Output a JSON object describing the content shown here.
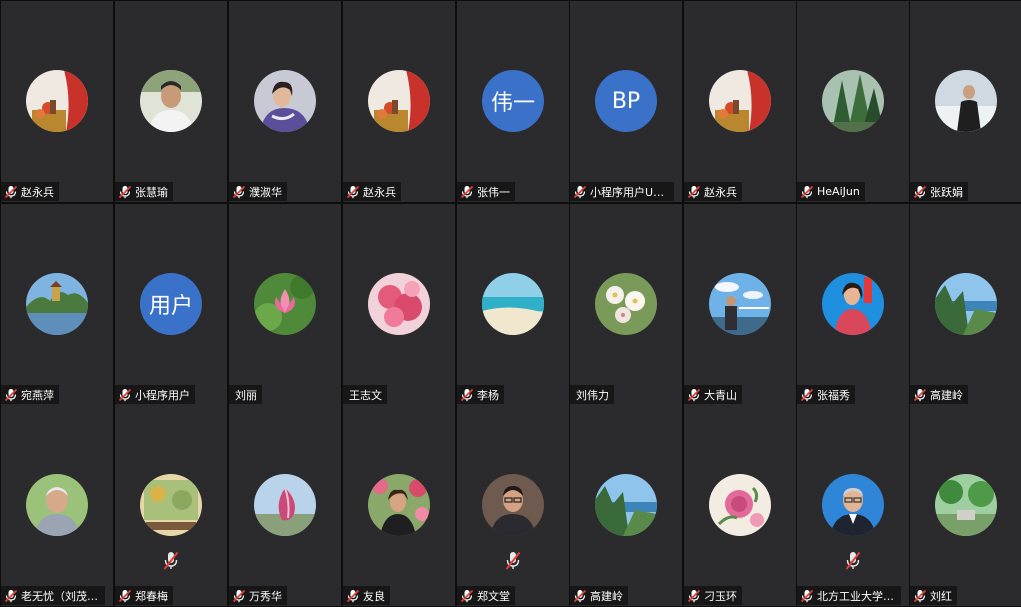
{
  "meeting": {
    "participants": [
      {
        "name": "赵永兵",
        "avatar": "photo-red-wall",
        "mic": "muted",
        "center_mute": false
      },
      {
        "name": "张慧瑜",
        "avatar": "photo-man-portrait",
        "mic": "muted",
        "center_mute": false
      },
      {
        "name": "濮淑华",
        "avatar": "photo-woman-portrait",
        "mic": "muted",
        "center_mute": false
      },
      {
        "name": "赵永兵",
        "avatar": "photo-red-wall",
        "mic": "muted",
        "center_mute": false
      },
      {
        "name": "张伟一",
        "avatar": "initials",
        "initials": "伟一",
        "mic": "muted",
        "center_mute": false
      },
      {
        "name": "小程序用户UorA…",
        "avatar": "initials",
        "initials": "BP",
        "mic": "muted",
        "center_mute": false
      },
      {
        "name": "赵永兵",
        "avatar": "photo-red-wall",
        "mic": "muted",
        "center_mute": false
      },
      {
        "name": "HeAiJun",
        "avatar": "photo-trees",
        "mic": "muted",
        "center_mute": false
      },
      {
        "name": "张跃娟",
        "avatar": "photo-snow-person",
        "mic": "muted",
        "center_mute": false
      },
      {
        "name": "宛燕萍",
        "avatar": "photo-palace-lake",
        "mic": "muted",
        "center_mute": false
      },
      {
        "name": "小程序用户",
        "avatar": "initials",
        "initials": "用户",
        "mic": "muted",
        "center_mute": false
      },
      {
        "name": "刘丽",
        "avatar": "photo-pink-lotus",
        "mic": "none",
        "center_mute": false
      },
      {
        "name": "王志文",
        "avatar": "photo-pink-blossom",
        "mic": "none",
        "center_mute": false
      },
      {
        "name": "李杨",
        "avatar": "photo-beach",
        "mic": "muted",
        "center_mute": false
      },
      {
        "name": "刘伟力",
        "avatar": "photo-white-blossom",
        "mic": "none",
        "center_mute": false
      },
      {
        "name": "大青山",
        "avatar": "photo-man-sky",
        "mic": "muted",
        "center_mute": false
      },
      {
        "name": "张福秀",
        "avatar": "photo-woman-blue",
        "mic": "muted",
        "center_mute": false
      },
      {
        "name": "高建岭",
        "avatar": "photo-coast",
        "mic": "muted",
        "center_mute": false
      },
      {
        "name": "老无忧（刘茂华）",
        "avatar": "photo-old-man",
        "mic": "muted",
        "center_mute": false
      },
      {
        "name": "郑春梅",
        "avatar": "photo-painting",
        "mic": "muted",
        "center_mute": true
      },
      {
        "name": "万秀华",
        "avatar": "photo-magnolia",
        "mic": "muted",
        "center_mute": false
      },
      {
        "name": "友良",
        "avatar": "photo-woman-flowers",
        "mic": "muted",
        "center_mute": false
      },
      {
        "name": "郑文堂",
        "avatar": "photo-man-glasses",
        "mic": "muted",
        "center_mute": true
      },
      {
        "name": "高建岭",
        "avatar": "photo-coast",
        "mic": "muted",
        "center_mute": false
      },
      {
        "name": "刁玉环",
        "avatar": "photo-peony",
        "mic": "muted",
        "center_mute": false
      },
      {
        "name": "北方工业大学张…",
        "avatar": "photo-man-suit",
        "mic": "muted",
        "center_mute": true
      },
      {
        "name": "刘红",
        "avatar": "photo-park",
        "mic": "muted",
        "center_mute": false
      }
    ]
  },
  "colors": {
    "tile_bg": "#2b2b2d",
    "initials_bg": "#3a72c9",
    "mute_red": "#e0403a",
    "label_text": "#ffffff"
  }
}
